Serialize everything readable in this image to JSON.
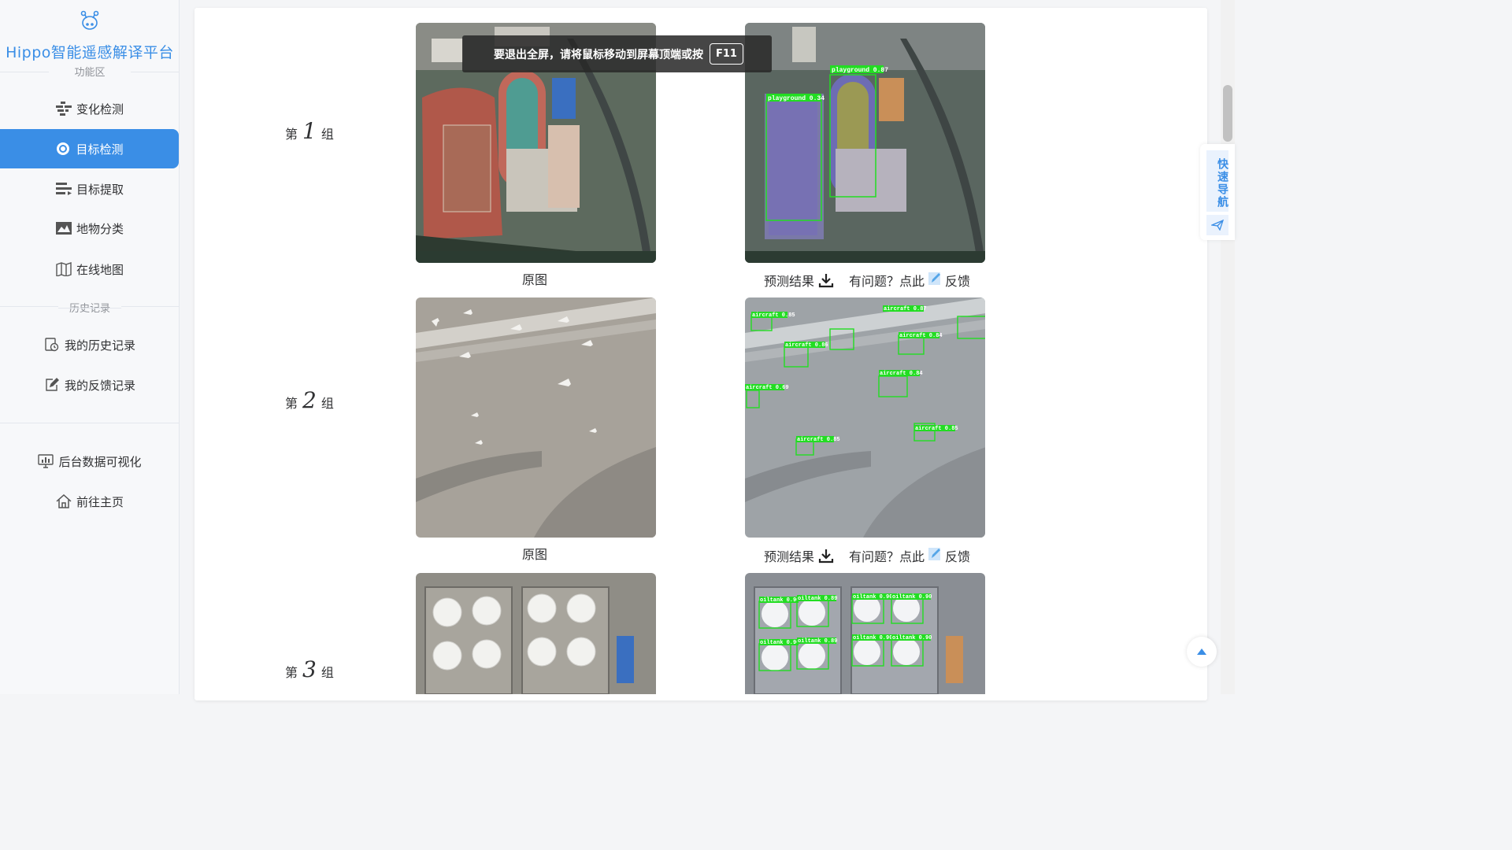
{
  "brand": {
    "title": "Hippo智能遥感解译平台"
  },
  "sidebar": {
    "section_function": "功能区",
    "items": [
      {
        "label": "变化检测",
        "icon": "change-detect-icon"
      },
      {
        "label": "目标检测",
        "icon": "target-detect-icon",
        "active": true
      },
      {
        "label": "目标提取",
        "icon": "target-extract-icon"
      },
      {
        "label": "地物分类",
        "icon": "land-classify-icon"
      },
      {
        "label": "在线地图",
        "icon": "map-icon"
      }
    ],
    "section_history": "历史记录",
    "history_items": [
      {
        "label": "我的历史记录",
        "icon": "history-icon"
      },
      {
        "label": "我的反馈记录",
        "icon": "feedback-edit-icon"
      }
    ],
    "bottom_items": [
      {
        "label": "后台数据可视化",
        "icon": "monitor-chart-icon"
      },
      {
        "label": "前往主页",
        "icon": "home-icon"
      }
    ]
  },
  "fullscreen_banner": {
    "text": "要退出全屏，请将鼠标移动到屏幕顶端或按",
    "key": "F11"
  },
  "groups": [
    {
      "prefix": "第",
      "number": "1",
      "suffix": "组",
      "original_caption": "原图",
      "result_label": "预测结果",
      "feedback_prefix": "有问题？点此",
      "feedback_suffix": "反馈",
      "detections": [
        "playground 0.34",
        "playground 0.87"
      ]
    },
    {
      "prefix": "第",
      "number": "2",
      "suffix": "组",
      "original_caption": "原图",
      "result_label": "预测结果",
      "feedback_prefix": "有问题？点此",
      "feedback_suffix": "反馈",
      "detections": [
        "aircraft 0.85",
        "aircraft 0.86",
        "aircraft 0.84",
        "aircraft 0.84",
        "aircraft 0.69",
        "aircraft 0.85",
        "aircraft 0.85",
        "aircraft 0.87"
      ]
    },
    {
      "prefix": "第",
      "number": "3",
      "suffix": "组",
      "detections": [
        "oiltank 0.90",
        "oiltank 0.89",
        "oiltank 0.90",
        "oiltank 0.90",
        "oiltank 0.90",
        "oiltank 0.89",
        "oiltank 0.90",
        "oiltank 0.90"
      ]
    }
  ],
  "quick_nav": {
    "label": "快速导航"
  },
  "colors": {
    "accent": "#3a8ee6",
    "detection_box": "#22dd22"
  }
}
